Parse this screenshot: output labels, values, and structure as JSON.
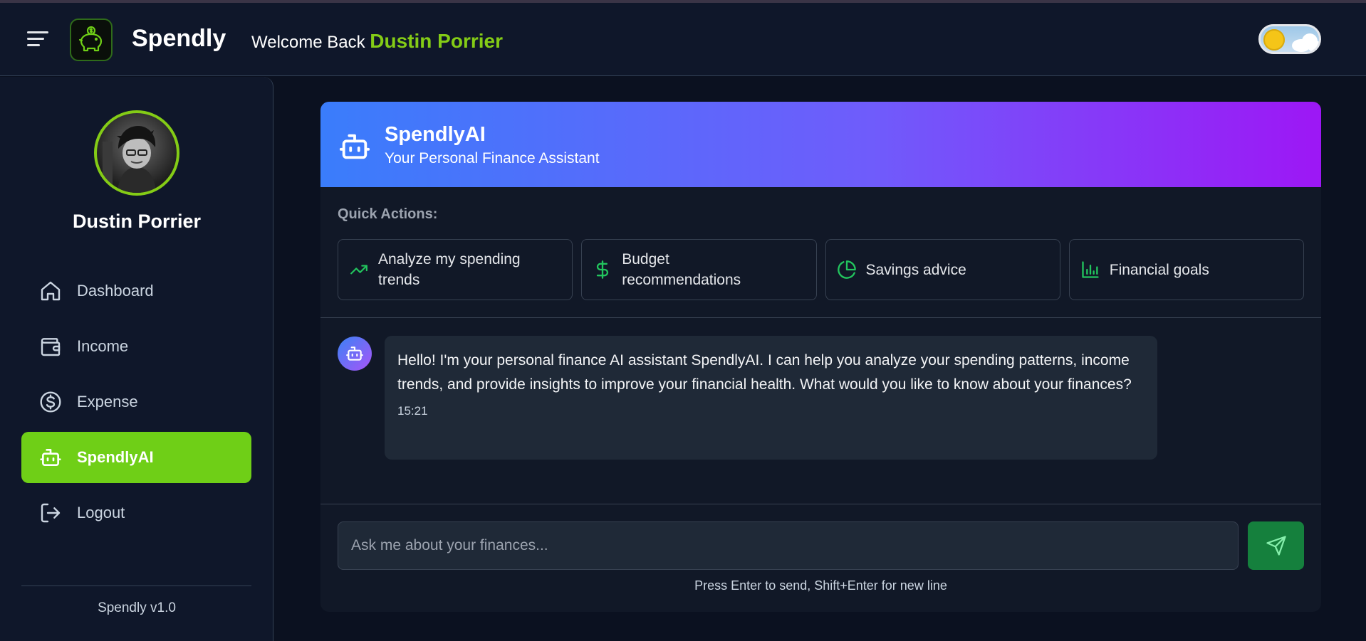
{
  "header": {
    "brand": "Spendly",
    "welcome_prefix": "Welcome Back",
    "user_name": "Dustin Porrier"
  },
  "sidebar": {
    "user_name": "Dustin Porrier",
    "items": [
      {
        "label": "Dashboard",
        "icon": "home-icon"
      },
      {
        "label": "Income",
        "icon": "wallet-icon"
      },
      {
        "label": "Expense",
        "icon": "dollar-circle-icon"
      },
      {
        "label": "SpendlyAI",
        "icon": "bot-icon",
        "active": true
      },
      {
        "label": "Logout",
        "icon": "logout-icon"
      }
    ],
    "version": "Spendly v1.0"
  },
  "chat": {
    "title": "SpendlyAI",
    "subtitle": "Your Personal Finance Assistant",
    "quick_actions_label": "Quick Actions:",
    "quick_actions": [
      {
        "label": "Analyze my spending trends",
        "icon": "trending-up-icon"
      },
      {
        "label": "Budget recommendations",
        "icon": "dollar-icon"
      },
      {
        "label": "Savings advice",
        "icon": "pie-chart-icon"
      },
      {
        "label": "Financial goals",
        "icon": "bar-chart-icon"
      }
    ],
    "messages": [
      {
        "text": "Hello! I'm your personal finance AI assistant SpendlyAI. I can help you analyze your spending patterns, income trends, and provide insights to improve your financial health. What would you like to know about your finances?",
        "time": "15:21"
      }
    ],
    "input_placeholder": "Ask me about your finances...",
    "hint": "Press Enter to send, Shift+Enter for new line"
  },
  "colors": {
    "accent_green": "#84cc16",
    "active_nav": "#6fcf17",
    "send_button": "#15803d",
    "header_gradient_start": "#3a7dfb",
    "header_gradient_end": "#9d17f5"
  }
}
